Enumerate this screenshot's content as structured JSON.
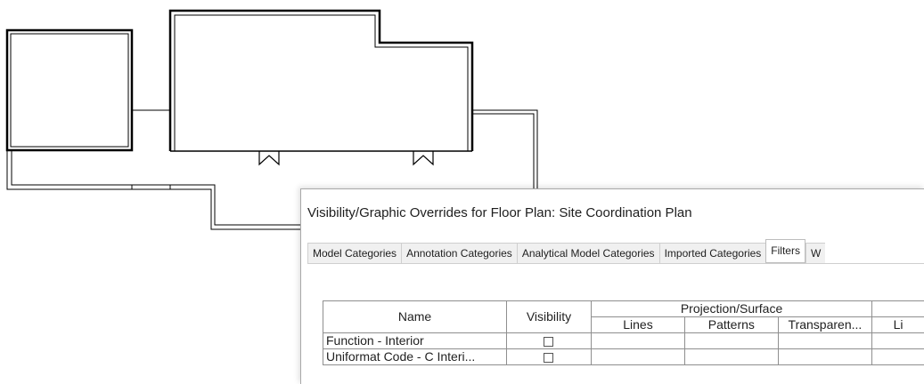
{
  "dialog": {
    "title": "Visibility/Graphic Overrides for Floor Plan: Site Coordination Plan",
    "tabs": [
      {
        "label": "Model Categories",
        "active": false
      },
      {
        "label": "Annotation Categories",
        "active": false
      },
      {
        "label": "Analytical Model Categories",
        "active": false
      },
      {
        "label": "Imported Categories",
        "active": false
      },
      {
        "label": "Filters",
        "active": true
      },
      {
        "label": "W",
        "active": false
      }
    ]
  },
  "filters_table": {
    "headers": {
      "name": "Name",
      "visibility": "Visibility",
      "projection_surface": "Projection/Surface",
      "lines": "Lines",
      "patterns": "Patterns",
      "transparency": "Transparen...",
      "cut_lines_partial": "Li"
    },
    "rows": [
      {
        "name": "Function - Interior",
        "visible": false
      },
      {
        "name": "Uniformat Code - C Interi...",
        "visible": false
      }
    ]
  },
  "colors": {
    "dialog_border": "#a9a9a9",
    "grid_border": "#8f8f8f",
    "drawing_lines": "#000000"
  }
}
